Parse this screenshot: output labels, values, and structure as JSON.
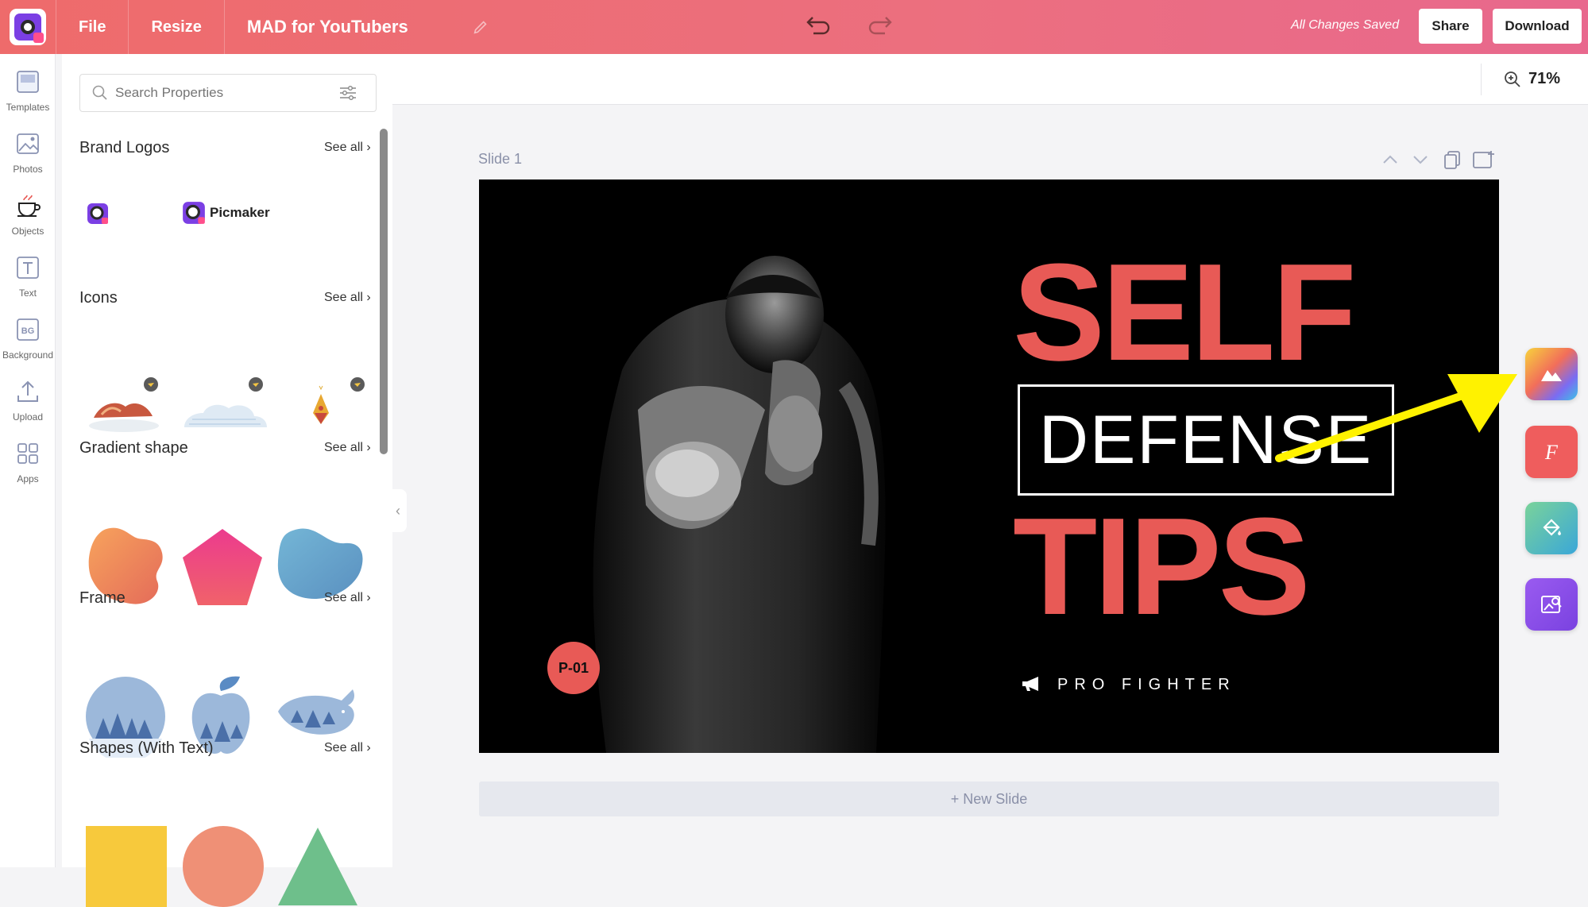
{
  "topbar": {
    "file": "File",
    "resize": "Resize",
    "doc_title": "MAD for YouTubers",
    "status": "All Changes Saved",
    "share": "Share",
    "download": "Download"
  },
  "rail": {
    "items": [
      {
        "label": "Templates",
        "icon": "templates-icon"
      },
      {
        "label": "Photos",
        "icon": "photos-icon"
      },
      {
        "label": "Objects",
        "icon": "objects-icon"
      },
      {
        "label": "Text",
        "icon": "text-icon"
      },
      {
        "label": "Background",
        "icon": "background-icon"
      },
      {
        "label": "Upload",
        "icon": "upload-icon"
      },
      {
        "label": "Apps",
        "icon": "apps-icon"
      }
    ]
  },
  "panel": {
    "search_placeholder": "Search Properties",
    "sections": [
      {
        "title": "Brand Logos",
        "see_all": "See all"
      },
      {
        "title": "Icons",
        "see_all": "See all"
      },
      {
        "title": "Gradient shape",
        "see_all": "See all"
      },
      {
        "title": "Frame",
        "see_all": "See all"
      },
      {
        "title": "Shapes (With Text)",
        "see_all": "See all"
      }
    ],
    "brand_logo_text": "Picmaker"
  },
  "canvas": {
    "zoom": "71%",
    "slide_label": "Slide 1",
    "new_slide": "+ New Slide"
  },
  "slide": {
    "line1": "SELF",
    "line2": "DEFENSE",
    "line3": "TIPS",
    "tagline": "PRO FIGHTER",
    "badge": "P-01"
  },
  "colors": {
    "brand_gradient_start": "#ee6b6b",
    "accent_red": "#e85a56",
    "arrow_yellow": "#fff200"
  }
}
